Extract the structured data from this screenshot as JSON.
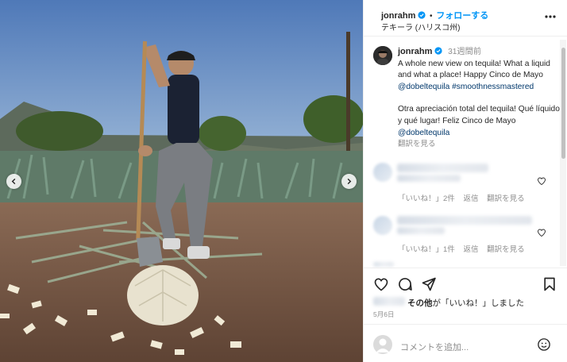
{
  "header": {
    "username": "jonrahm",
    "follow_label": "フォローする",
    "location": "テキーラ (ハリスコ州)",
    "more_icon": "more-horizontal-icon"
  },
  "caption": {
    "username": "jonrahm",
    "time_ago": "31週間前",
    "text_en": "A whole new view on tequila! What a liquid and what a place! Happy Cinco de Mayo",
    "mention": "@dobeltequila",
    "hashtag": "#smoothnessmastered",
    "text_es": "Otra apreciación total del tequila! Qué líquido y qué lugar! Feliz Cinco de Mayo",
    "mention2": "@dobeltequila",
    "translate": "翻訳を見る"
  },
  "comments": [
    {
      "likes": "「いいね！」2件",
      "reply": "返信",
      "translate": "翻訳を見る"
    },
    {
      "likes": "「いいね！」1件",
      "reply": "返信",
      "translate": "翻訳を見る"
    }
  ],
  "likes_summary": {
    "others": "その他",
    "suffix": "が「いいね！」しました"
  },
  "date": "5月6日",
  "comment_input": {
    "placeholder": "コメントを追加...",
    "emoji_icon": "smiley-icon"
  },
  "icons": {
    "like": "heart-icon",
    "comment": "comment-icon",
    "share": "send-icon",
    "save": "bookmark-icon"
  },
  "colors": {
    "accent": "#0095f6",
    "link": "#00376b",
    "muted": "#8e8e8e",
    "text": "#262626"
  }
}
